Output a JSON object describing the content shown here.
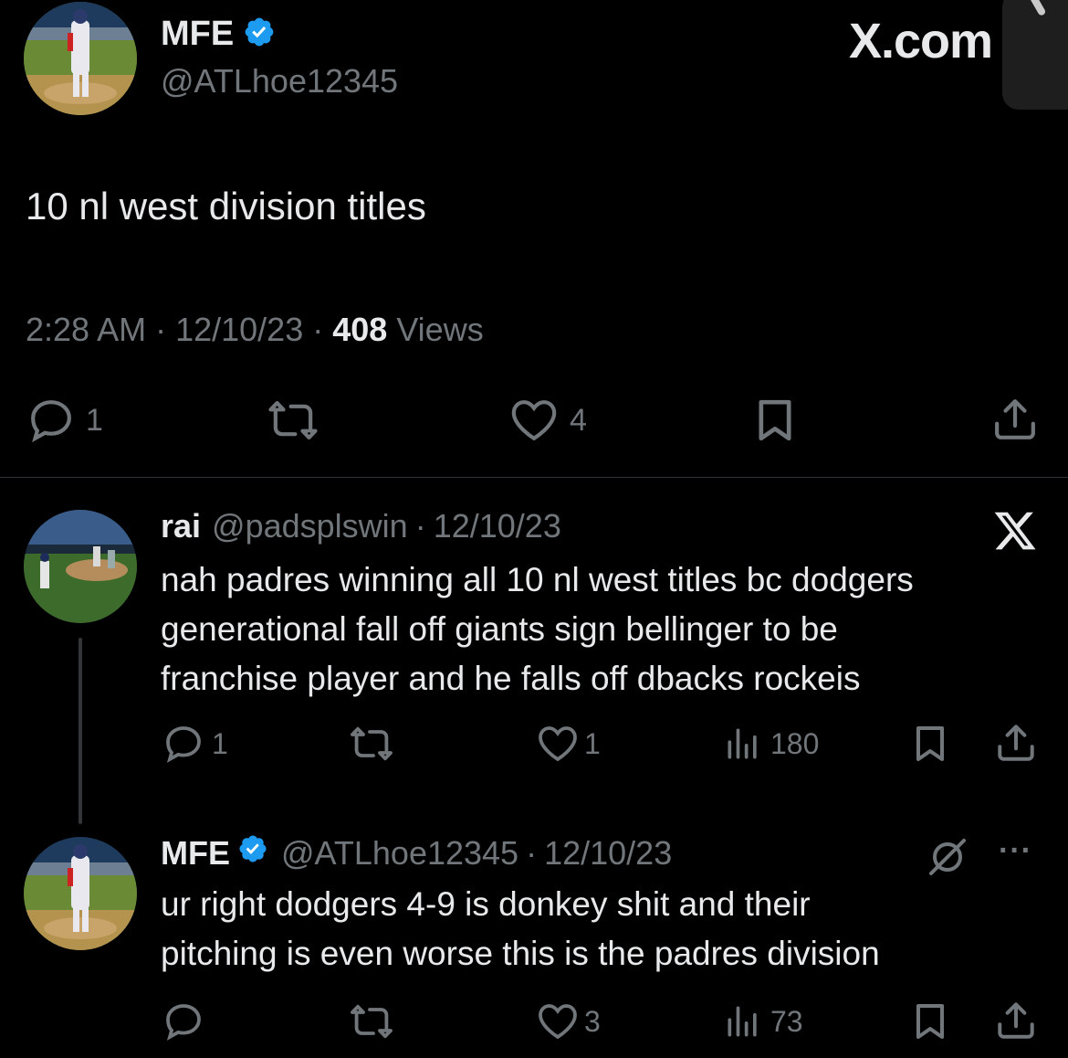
{
  "main_tweet": {
    "display_name": "MFE",
    "handle": "@ATLhoe12345",
    "brand": "X.com",
    "text": "10 nl west division titles",
    "time": "2:28 AM",
    "sep1": "·",
    "date": "12/10/23",
    "sep2": "·",
    "views_count": "408",
    "views_label": "Views",
    "actions": {
      "replies": "1",
      "likes": "4"
    }
  },
  "replies": [
    {
      "display_name": "rai",
      "handle": "@padsplswin",
      "sep": "·",
      "date": "12/10/23",
      "text_lines": [
        "nah padres winning all 10 nl west titles bc dodgers",
        "generational fall off giants sign bellinger to be",
        "franchise player and he falls off dbacks rockeis"
      ],
      "actions": {
        "replies": "1",
        "likes": "1",
        "views": "180"
      }
    },
    {
      "display_name": "MFE",
      "handle": "@ATLhoe12345",
      "sep": "·",
      "date": "12/10/23",
      "more": "···",
      "text_lines": [
        "ur right dodgers 4-9 is donkey shit and their",
        "pitching is even worse this is the padres division"
      ],
      "actions": {
        "likes": "3",
        "views": "73"
      }
    }
  ],
  "colors": {
    "background": "#000000",
    "text": "#e7e9ea",
    "secondary": "#71767b",
    "verified": "#1d9bf0",
    "divider": "#2f3336"
  },
  "icons": [
    "verified-icon",
    "x-logo-icon",
    "reply-icon",
    "retweet-icon",
    "like-icon",
    "bookmark-icon",
    "share-icon",
    "views-icon",
    "muted-icon",
    "more-icon"
  ]
}
